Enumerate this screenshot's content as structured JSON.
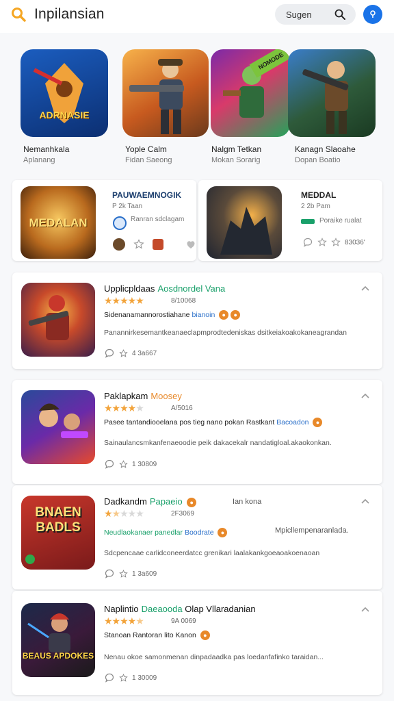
{
  "header": {
    "title": "Inpilansian",
    "search_label": "Sugen"
  },
  "carousel": [
    {
      "title": "Nemanhkala",
      "sub": "Aplanang",
      "tile_text": "ADRNASIE"
    },
    {
      "title": "Yople Calm",
      "sub": "Fidan Saeong"
    },
    {
      "title": "Nalgm Tetkan",
      "sub": "Mokan Sorarig",
      "tile_text": "NOMODE"
    },
    {
      "title": "Kanagn Slaoahe",
      "sub": "Dopan Boatio"
    }
  ],
  "featured": [
    {
      "title": "PAUWAEMNOGIK",
      "sub1": "P 2k Taan",
      "sub2": "Ranran sdclagam",
      "art_text": "MEDALAN"
    },
    {
      "title": "MEDDAL",
      "sub1": "2 2b Pam",
      "sub2": "Poraike rualat",
      "count": "83036'"
    }
  ],
  "apps": [
    {
      "title": "Upplicpldaas",
      "title_accent": "Aosdnordel Vana",
      "rating": 4.5,
      "rating_count": "8/10068",
      "sub": "Sidenanamannorostiahane",
      "sub_accent": "bianoin",
      "desc": "Panannirkesemantkeanaeclapmprodtedeniskas dsitkeiakoakokaneagrandan",
      "count": "4 3a667"
    },
    {
      "title": "Paklapkam",
      "title_accent": "Moosey",
      "rating": 4,
      "rating_count": "A/5016",
      "sub": "Pasee tantandiooelana pos tieg nano pokan Rastkant",
      "sub_accent": "Bacoadon",
      "desc": "Sainaulancsmkanfenaeoodie peik dakacekalr nandatigloal.akaokonkan.",
      "count": "1 30809"
    },
    {
      "title": "Dadkandm",
      "title_accent": "Papaeio",
      "right_label": "Ian kona",
      "rating": 1.5,
      "rating_count": "2F3069",
      "sub": "Neudlaokanaer panedlar",
      "sub_accent": "Boodrate",
      "extra": "Mpicllempenaranlada.",
      "desc": "Sdcpencaae carlidconeerdatcc grenikari laalakankgoeaoakoenaoan",
      "count": "1 3a609",
      "art_text": "BNAEN BADLS"
    },
    {
      "title": "Naplintio",
      "title_accent": "Daeaooda",
      "title_tail": "Olap Vllaradanian",
      "rating": 4.5,
      "rating_count": "9A 0069",
      "sub": "Stanoan Rantoran lito Kanon",
      "desc": "Nenau okoe samonmenan dinpadaadka pas loedanfafinko taraidan...",
      "count": "1 30009",
      "art_text": "BEAUS APDOKES"
    }
  ],
  "colors": {
    "accent": "#1a73e8",
    "star": "#f2a33a",
    "accent_green": "#19a06a",
    "accent_orange": "#e8892a",
    "accent_blue": "#2a6fc9"
  }
}
